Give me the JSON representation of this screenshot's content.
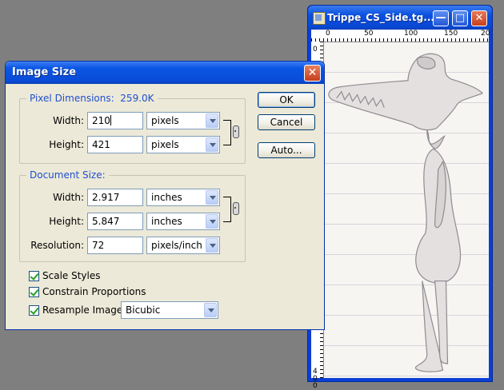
{
  "document_window": {
    "title": "Trippe_CS_Side.tg...",
    "ruler_top_labels": [
      "0",
      "50",
      "100",
      "150",
      "20"
    ],
    "ruler_left_labels": [
      "0",
      "5",
      "0",
      "1",
      "0",
      "0",
      "1",
      "5",
      "0",
      "2",
      "0",
      "0",
      "4",
      "0",
      "0"
    ],
    "controls": [
      "minimize-icon",
      "maximize-icon",
      "close-icon"
    ]
  },
  "dialog": {
    "title": "Image Size",
    "pixel_dimensions": {
      "label": "Pixel Dimensions:",
      "size": "259.0K",
      "width_label": "Width:",
      "width_value": "210",
      "width_unit": "pixels",
      "height_label": "Height:",
      "height_value": "421",
      "height_unit": "pixels"
    },
    "document_size": {
      "label": "Document Size:",
      "width_label": "Width:",
      "width_value": "2.917",
      "width_unit": "inches",
      "height_label": "Height:",
      "height_value": "5.847",
      "height_unit": "inches",
      "resolution_label": "Resolution:",
      "resolution_value": "72",
      "resolution_unit": "pixels/inch"
    },
    "buttons": {
      "ok": "OK",
      "cancel": "Cancel",
      "auto": "Auto..."
    },
    "checkboxes": {
      "scale_styles": "Scale Styles",
      "constrain_proportions": "Constrain Proportions",
      "resample_image": "Resample Image:"
    },
    "resample_method": "Bicubic"
  },
  "colors": {
    "xp_title_blue": "#0a50e0",
    "dialog_face": "#ece9d8",
    "group_title": "#1f4fcf",
    "desktop": "#7f7f7f"
  }
}
